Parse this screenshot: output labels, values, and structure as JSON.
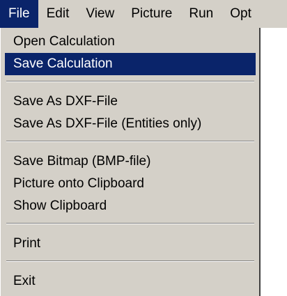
{
  "menubar": {
    "items": [
      {
        "label": "File",
        "active": true
      },
      {
        "label": "Edit",
        "active": false
      },
      {
        "label": "View",
        "active": false
      },
      {
        "label": "Picture",
        "active": false
      },
      {
        "label": "Run",
        "active": false
      },
      {
        "label": "Opt",
        "active": false
      }
    ]
  },
  "file_menu": {
    "items": [
      {
        "label": "Open Calculation"
      },
      {
        "label": "Save Calculation",
        "highlighted": true
      },
      {
        "label": "Save As  DXF-File"
      },
      {
        "label": "Save As  DXF-File  (Entities only)"
      },
      {
        "label": "Save Bitmap (BMP-file)"
      },
      {
        "label": "Picture onto Clipboard"
      },
      {
        "label": "Show Clipboard"
      },
      {
        "label": "Print"
      },
      {
        "label": "Exit"
      }
    ]
  },
  "colors": {
    "menu_background": "#d4d0c8",
    "highlight": "#0a246a",
    "highlight_text": "#ffffff"
  }
}
